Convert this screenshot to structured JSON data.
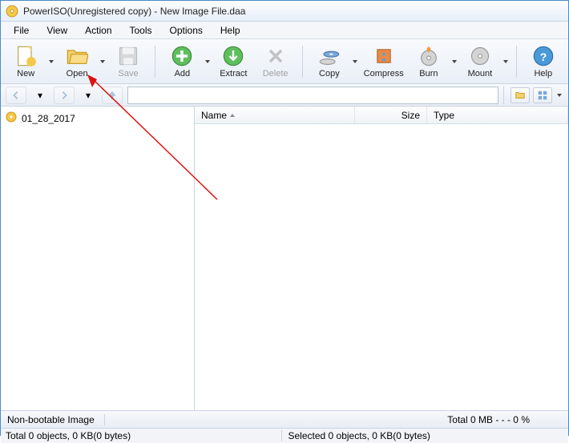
{
  "title": "PowerISO(Unregistered copy) - New Image File.daa",
  "menu": {
    "file": "File",
    "view": "View",
    "action": "Action",
    "tools": "Tools",
    "options": "Options",
    "help": "Help"
  },
  "toolbar": {
    "new": "New",
    "open": "Open",
    "save": "Save",
    "add": "Add",
    "extract": "Extract",
    "delete": "Delete",
    "copy": "Copy",
    "compress": "Compress",
    "burn": "Burn",
    "mount": "Mount",
    "help": "Help"
  },
  "tree": {
    "item0": "01_28_2017"
  },
  "list": {
    "col_name": "Name",
    "col_size": "Size",
    "col_type": "Type"
  },
  "footer": {
    "boot": "Non-bootable Image",
    "total": "Total  0 MB   - - -  0 %",
    "status_left": "Total 0 objects, 0 KB(0 bytes)",
    "status_right": "Selected 0 objects, 0 KB(0 bytes)"
  }
}
